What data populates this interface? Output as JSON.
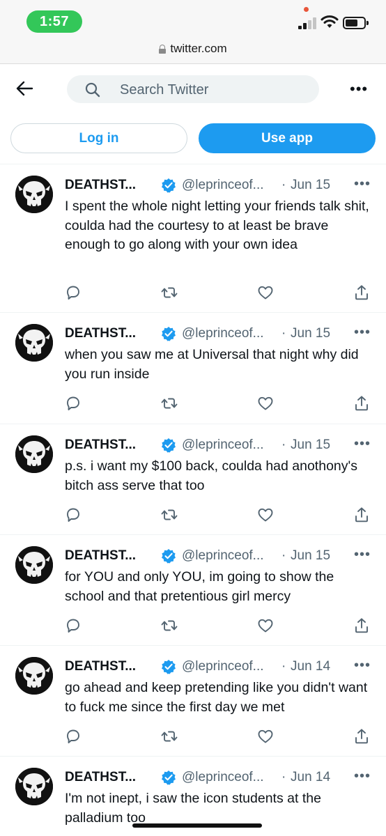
{
  "status_bar": {
    "time": "1:57"
  },
  "browser": {
    "url": "twitter.com"
  },
  "header": {
    "search_placeholder": "Search Twitter"
  },
  "buttons": {
    "login": "Log in",
    "use_app": "Use app"
  },
  "tweets": [
    {
      "name": "DEATHST...",
      "handle": "@leprinceof...",
      "dot": "·",
      "date": "Jun 15",
      "text": "I spent the whole night letting your friends talk shit, coulda had the courtesy to at least be brave enough to go along with your own idea"
    },
    {
      "name": "DEATHST...",
      "handle": "@leprinceof...",
      "dot": "·",
      "date": "Jun 15",
      "text": "when you saw me at Universal that night why did you run inside"
    },
    {
      "name": "DEATHST...",
      "handle": "@leprinceof...",
      "dot": "·",
      "date": "Jun 15",
      "text": "p.s. i want my $100 back, coulda had anothony's bitch ass serve that too"
    },
    {
      "name": "DEATHST...",
      "handle": "@leprinceof...",
      "dot": "·",
      "date": "Jun 15",
      "text": "for YOU and only YOU, im going to show the school and that pretentious girl mercy"
    },
    {
      "name": "DEATHST...",
      "handle": "@leprinceof...",
      "dot": "·",
      "date": "Jun 14",
      "text": "go ahead and keep pretending like you didn't want to fuck me since the first day we met"
    },
    {
      "name": "DEATHST...",
      "handle": "@leprinceof...",
      "dot": "·",
      "date": "Jun 14",
      "text": "I'm not inept, i saw the icon students at the palladium too"
    }
  ],
  "colors": {
    "accent": "#1d9bf0",
    "status_green": "#33c759",
    "muted": "#536471"
  },
  "icons": [
    "lock-icon",
    "back-arrow-icon",
    "search-icon",
    "more-icon",
    "verified-badge-icon",
    "reply-icon",
    "retweet-icon",
    "like-icon",
    "share-icon",
    "skull-avatar"
  ]
}
